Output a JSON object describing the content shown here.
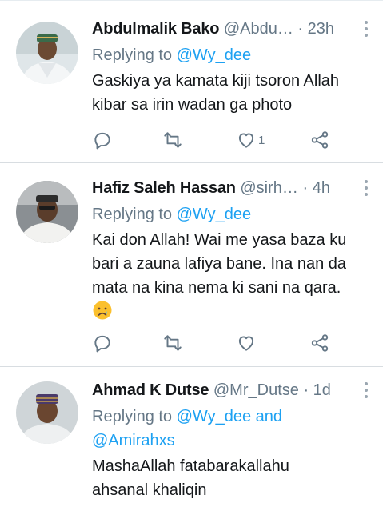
{
  "tweets": [
    {
      "name": "Abdulmalik Bako",
      "handle": "@Abdu…",
      "time": "23h",
      "reply_prefix": "Replying to ",
      "reply_to": "@Wy_dee",
      "reply_extra": "",
      "text_lines": [
        "Gaskiya ya kamata kiji tsoron Allah",
        "kibar sa irin wadan ga photo"
      ],
      "emoji": "",
      "like_count": "1"
    },
    {
      "name": "Hafiz Saleh Hassan",
      "handle": "@sirh…",
      "time": "4h",
      "reply_prefix": "Replying to ",
      "reply_to": "@Wy_dee",
      "reply_extra": "",
      "text_lines": [
        "Kai don Allah! Wai me yasa baza ku",
        "bari a zauna lafiya bane. Ina nan da",
        "mata na kina nema ki sani na qara."
      ],
      "emoji": "crying-face",
      "like_count": ""
    },
    {
      "name": "Ahmad K Dutse",
      "handle": "@Mr_Dutse",
      "time": "1d",
      "reply_prefix": "Replying to ",
      "reply_to": "@Wy_dee and",
      "reply_extra": "@Amirahxs",
      "text_lines": [
        "MashaAllah fatabarakallahu",
        "ahsanal khaliqin"
      ],
      "emoji": "",
      "like_count": ""
    }
  ],
  "separator": "·",
  "icons": {
    "reply": "reply-icon",
    "retweet": "retweet-icon",
    "like": "heart-icon",
    "share": "share-icon",
    "more": "more-vertical-icon"
  },
  "colors": {
    "link": "#1da1f2",
    "muted": "#657786",
    "text": "#14171a",
    "icon": "#657786",
    "divider": "#d8dde1"
  }
}
